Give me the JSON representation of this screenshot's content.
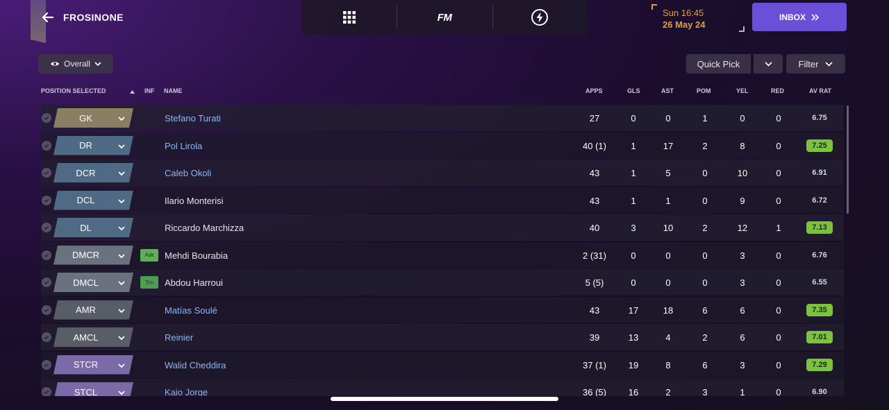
{
  "header": {
    "club": "FROSINONE",
    "date_time": "Sun 16:45",
    "date": "26 May 24",
    "inbox_label": "INBOX",
    "fm_label": "FM"
  },
  "toolbar": {
    "overall_label": "Overall",
    "quick_pick_label": "Quick Pick",
    "filter_label": "Filter"
  },
  "columns": {
    "position": "POSITION SELECTED",
    "inf": "INF",
    "name": "NAME",
    "apps": "APPS",
    "gls": "GLS",
    "ast": "AST",
    "pom": "POM",
    "yel": "YEL",
    "red": "RED",
    "av_rat": "AV RAT"
  },
  "colors": {
    "accent": "#6a4fd9",
    "date": "#e0a040",
    "gk": "#8a7f62",
    "def": "#4f6a84",
    "dm": "#6a7280",
    "am": "#585d66",
    "st": "#7a6aa8",
    "rating_good": "#7cc23e",
    "link_name": "#8fb6f2"
  },
  "players": [
    {
      "pos": "GK",
      "group": "gk",
      "inf": "",
      "name": "Stefano Turati",
      "linked": true,
      "apps": "27",
      "gls": "0",
      "ast": "0",
      "pom": "1",
      "yel": "0",
      "red": "0",
      "rat": "6.75",
      "highlight": false
    },
    {
      "pos": "DR",
      "group": "def",
      "inf": "",
      "name": "Pol Lirola",
      "linked": true,
      "apps": "40 (1)",
      "gls": "1",
      "ast": "17",
      "pom": "2",
      "yel": "8",
      "red": "0",
      "rat": "7.25",
      "highlight": true
    },
    {
      "pos": "DCR",
      "group": "def",
      "inf": "",
      "name": "Caleb Okoli",
      "linked": true,
      "apps": "43",
      "gls": "1",
      "ast": "5",
      "pom": "0",
      "yel": "10",
      "red": "0",
      "rat": "6.91",
      "highlight": false
    },
    {
      "pos": "DCL",
      "group": "def",
      "inf": "",
      "name": "Ilario Monterisi",
      "linked": false,
      "apps": "43",
      "gls": "1",
      "ast": "1",
      "pom": "0",
      "yel": "9",
      "red": "0",
      "rat": "6.72",
      "highlight": false
    },
    {
      "pos": "DL",
      "group": "def",
      "inf": "",
      "name": "Riccardo Marchizza",
      "linked": false,
      "apps": "40",
      "gls": "3",
      "ast": "10",
      "pom": "2",
      "yel": "12",
      "red": "1",
      "rat": "7.13",
      "highlight": true
    },
    {
      "pos": "DMCR",
      "group": "dm",
      "inf": "Ask",
      "name": "Mehdi Bourabia",
      "linked": false,
      "apps": "2 (31)",
      "gls": "0",
      "ast": "0",
      "pom": "0",
      "yel": "3",
      "red": "0",
      "rat": "6.76",
      "highlight": false
    },
    {
      "pos": "DMCL",
      "group": "dm",
      "inf": "Trn",
      "name": "Abdou Harroui",
      "linked": false,
      "apps": "5 (5)",
      "gls": "0",
      "ast": "0",
      "pom": "0",
      "yel": "3",
      "red": "0",
      "rat": "6.55",
      "highlight": false
    },
    {
      "pos": "AMR",
      "group": "am",
      "inf": "",
      "name": "Matías Soulé",
      "linked": true,
      "apps": "43",
      "gls": "17",
      "ast": "18",
      "pom": "6",
      "yel": "6",
      "red": "0",
      "rat": "7.35",
      "highlight": true
    },
    {
      "pos": "AMCL",
      "group": "am",
      "inf": "",
      "name": "Reinier",
      "linked": true,
      "apps": "39",
      "gls": "13",
      "ast": "4",
      "pom": "2",
      "yel": "6",
      "red": "0",
      "rat": "7.01",
      "highlight": true
    },
    {
      "pos": "STCR",
      "group": "st",
      "inf": "",
      "name": "Walid Cheddira",
      "linked": true,
      "apps": "37 (1)",
      "gls": "19",
      "ast": "8",
      "pom": "6",
      "yel": "3",
      "red": "0",
      "rat": "7.29",
      "highlight": true
    },
    {
      "pos": "STCL",
      "group": "st",
      "inf": "",
      "name": "Kaio Jorge",
      "linked": true,
      "apps": "36 (5)",
      "gls": "16",
      "ast": "2",
      "pom": "3",
      "yel": "1",
      "red": "0",
      "rat": "6.90",
      "highlight": false
    }
  ]
}
